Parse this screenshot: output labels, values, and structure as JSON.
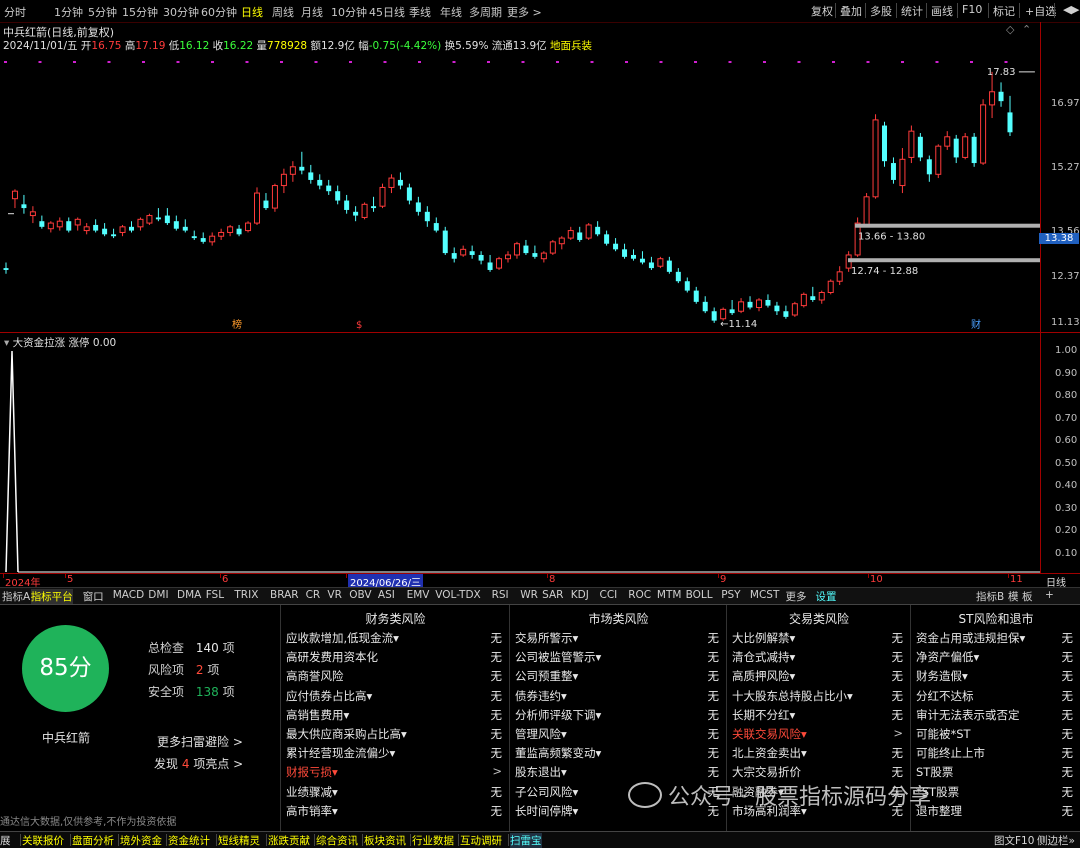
{
  "toolbar": {
    "periods": [
      "分时",
      "1分钟",
      "5分钟",
      "15分钟",
      "30分钟",
      "60分钟",
      "日线",
      "周线",
      "月线",
      "10分钟",
      "45日线",
      "季线",
      "年线",
      "多周期",
      "更多 >"
    ],
    "active_period": "日线",
    "right_buttons": [
      "复权",
      "叠加",
      "多股",
      "统计",
      "画线",
      "F10",
      "标记",
      "+自选",
      "◀",
      "▶"
    ]
  },
  "info": {
    "stock_title": "中兵红箭(日线,前复权)",
    "date": "2024/11/01/五",
    "open_label": "开",
    "open": "16.75",
    "high_label": "高",
    "high": "17.19",
    "low_label": "低",
    "low": "16.12",
    "close_label": "收",
    "close": "16.22",
    "vol_label": "量",
    "vol": "778928",
    "amount_label": "额",
    "amount": "12.9亿",
    "change_label": "幅",
    "change": "-0.75(-4.42%)",
    "turnover_label": "换",
    "turnover": "5.59%",
    "float_label": "流通",
    "float": "13.9亿",
    "concept": "地面兵装"
  },
  "price_axis": {
    "ticks": [
      "16.97",
      "15.27",
      "13.56",
      "12.37",
      "11.13"
    ],
    "current": "13.38"
  },
  "chart_data": {
    "type": "candlestick",
    "annotations": {
      "high_label": "17.83",
      "low_label": "11.14",
      "zone_upper": "13.66 - 13.80",
      "zone_lower": "12.74 - 12.88"
    },
    "markers": [
      "榜",
      "$",
      "财"
    ],
    "ohlc": [
      [
        12.6,
        12.75,
        12.45,
        12.55
      ],
      [
        14.45,
        14.7,
        14.2,
        14.65
      ],
      [
        14.3,
        14.55,
        14.05,
        14.2
      ],
      [
        14.0,
        14.25,
        13.8,
        14.1
      ],
      [
        13.85,
        14.0,
        13.65,
        13.7
      ],
      [
        13.65,
        13.85,
        13.55,
        13.8
      ],
      [
        13.7,
        13.95,
        13.6,
        13.85
      ],
      [
        13.85,
        13.95,
        13.55,
        13.6
      ],
      [
        13.75,
        13.95,
        13.6,
        13.9
      ],
      [
        13.6,
        13.8,
        13.5,
        13.7
      ],
      [
        13.75,
        13.9,
        13.55,
        13.6
      ],
      [
        13.65,
        13.8,
        13.45,
        13.5
      ],
      [
        13.5,
        13.65,
        13.4,
        13.45
      ],
      [
        13.55,
        13.75,
        13.45,
        13.7
      ],
      [
        13.7,
        13.85,
        13.55,
        13.6
      ],
      [
        13.7,
        13.95,
        13.6,
        13.9
      ],
      [
        13.8,
        14.05,
        13.75,
        14.0
      ],
      [
        13.95,
        14.2,
        13.85,
        13.9
      ],
      [
        14.0,
        14.2,
        13.75,
        13.8
      ],
      [
        13.85,
        14.0,
        13.6,
        13.65
      ],
      [
        13.7,
        13.9,
        13.55,
        13.6
      ],
      [
        13.45,
        13.6,
        13.35,
        13.4
      ],
      [
        13.4,
        13.55,
        13.25,
        13.3
      ],
      [
        13.3,
        13.55,
        13.2,
        13.45
      ],
      [
        13.45,
        13.65,
        13.35,
        13.55
      ],
      [
        13.55,
        13.75,
        13.45,
        13.7
      ],
      [
        13.65,
        13.75,
        13.45,
        13.5
      ],
      [
        13.6,
        13.85,
        13.55,
        13.8
      ],
      [
        13.8,
        14.75,
        13.75,
        14.6
      ],
      [
        14.4,
        14.6,
        14.15,
        14.2
      ],
      [
        14.2,
        14.85,
        14.1,
        14.8
      ],
      [
        14.8,
        15.25,
        14.6,
        15.1
      ],
      [
        15.1,
        15.45,
        14.9,
        15.3
      ],
      [
        15.3,
        15.7,
        15.1,
        15.2
      ],
      [
        15.15,
        15.35,
        14.85,
        14.95
      ],
      [
        14.95,
        15.1,
        14.7,
        14.8
      ],
      [
        14.8,
        14.95,
        14.55,
        14.65
      ],
      [
        14.65,
        14.8,
        14.3,
        14.4
      ],
      [
        14.4,
        14.55,
        14.05,
        14.15
      ],
      [
        14.1,
        14.25,
        13.85,
        14.0
      ],
      [
        13.95,
        14.35,
        13.9,
        14.3
      ],
      [
        14.25,
        14.5,
        14.1,
        14.2
      ],
      [
        14.25,
        14.85,
        14.2,
        14.75
      ],
      [
        14.75,
        15.1,
        14.6,
        15.0
      ],
      [
        14.95,
        15.15,
        14.7,
        14.8
      ],
      [
        14.75,
        14.85,
        14.3,
        14.4
      ],
      [
        14.35,
        14.5,
        14.0,
        14.1
      ],
      [
        14.1,
        14.25,
        13.7,
        13.85
      ],
      [
        13.8,
        13.95,
        13.55,
        13.6
      ],
      [
        13.6,
        13.7,
        12.95,
        13.0
      ],
      [
        13.0,
        13.15,
        12.75,
        12.85
      ],
      [
        12.95,
        13.2,
        12.9,
        13.1
      ],
      [
        13.05,
        13.2,
        12.85,
        12.95
      ],
      [
        12.95,
        13.05,
        12.7,
        12.8
      ],
      [
        12.75,
        12.95,
        12.5,
        12.55
      ],
      [
        12.6,
        12.9,
        12.55,
        12.85
      ],
      [
        12.85,
        13.05,
        12.75,
        12.95
      ],
      [
        12.95,
        13.3,
        12.85,
        13.25
      ],
      [
        13.2,
        13.35,
        12.95,
        13.0
      ],
      [
        13.0,
        13.2,
        12.85,
        12.9
      ],
      [
        12.85,
        13.05,
        12.75,
        13.0
      ],
      [
        13.0,
        13.35,
        12.95,
        13.3
      ],
      [
        13.25,
        13.45,
        13.1,
        13.4
      ],
      [
        13.4,
        13.7,
        13.35,
        13.6
      ],
      [
        13.55,
        13.7,
        13.3,
        13.35
      ],
      [
        13.4,
        13.8,
        13.35,
        13.75
      ],
      [
        13.7,
        13.85,
        13.45,
        13.5
      ],
      [
        13.5,
        13.6,
        13.2,
        13.25
      ],
      [
        13.25,
        13.4,
        13.05,
        13.1
      ],
      [
        13.1,
        13.25,
        12.85,
        12.9
      ],
      [
        12.95,
        13.1,
        12.8,
        12.85
      ],
      [
        12.85,
        13.05,
        12.7,
        12.75
      ],
      [
        12.75,
        12.9,
        12.55,
        12.6
      ],
      [
        12.65,
        12.9,
        12.6,
        12.85
      ],
      [
        12.8,
        12.9,
        12.45,
        12.5
      ],
      [
        12.5,
        12.6,
        12.2,
        12.25
      ],
      [
        12.25,
        12.35,
        11.95,
        12.0
      ],
      [
        12.0,
        12.1,
        11.65,
        11.7
      ],
      [
        11.7,
        11.85,
        11.4,
        11.45
      ],
      [
        11.45,
        11.55,
        11.14,
        11.2
      ],
      [
        11.25,
        11.55,
        11.2,
        11.5
      ],
      [
        11.5,
        11.75,
        11.35,
        11.4
      ],
      [
        11.45,
        11.8,
        11.4,
        11.7
      ],
      [
        11.7,
        11.85,
        11.5,
        11.55
      ],
      [
        11.55,
        11.8,
        11.45,
        11.75
      ],
      [
        11.75,
        11.9,
        11.55,
        11.6
      ],
      [
        11.6,
        11.7,
        11.35,
        11.45
      ],
      [
        11.45,
        11.6,
        11.25,
        11.3
      ],
      [
        11.35,
        11.7,
        11.3,
        11.65
      ],
      [
        11.6,
        11.95,
        11.55,
        11.9
      ],
      [
        11.85,
        12.1,
        11.7,
        11.75
      ],
      [
        11.75,
        12.0,
        11.65,
        11.95
      ],
      [
        11.95,
        12.3,
        11.9,
        12.25
      ],
      [
        12.25,
        12.65,
        12.15,
        12.5
      ],
      [
        12.6,
        13.05,
        12.5,
        12.95
      ],
      [
        12.95,
        13.95,
        12.9,
        13.8
      ],
      [
        13.75,
        14.6,
        13.7,
        14.5
      ],
      [
        14.5,
        16.7,
        14.45,
        16.55
      ],
      [
        16.4,
        16.5,
        15.3,
        15.45
      ],
      [
        15.4,
        15.55,
        14.85,
        14.95
      ],
      [
        14.8,
        15.8,
        14.6,
        15.5
      ],
      [
        15.55,
        16.4,
        15.4,
        16.25
      ],
      [
        16.1,
        16.2,
        15.45,
        15.55
      ],
      [
        15.5,
        15.6,
        14.9,
        15.1
      ],
      [
        15.1,
        15.9,
        15.0,
        15.85
      ],
      [
        15.85,
        16.25,
        15.75,
        16.1
      ],
      [
        16.05,
        16.15,
        15.4,
        15.55
      ],
      [
        15.55,
        16.2,
        15.5,
        16.1
      ],
      [
        16.1,
        16.2,
        15.3,
        15.4
      ],
      [
        15.4,
        17.1,
        15.35,
        16.95
      ],
      [
        16.95,
        17.83,
        16.6,
        17.3
      ],
      [
        17.3,
        17.55,
        16.9,
        17.05
      ],
      [
        16.75,
        17.19,
        16.12,
        16.22
      ]
    ],
    "indicator": {
      "name": "大资金拉涨",
      "series_name": "涨停",
      "value": "0.00",
      "ticks": [
        "1.00",
        "0.90",
        "0.80",
        "0.70",
        "0.60",
        "0.50",
        "0.40",
        "0.30",
        "0.20",
        "0.10"
      ]
    }
  },
  "date_axis": {
    "labels": [
      "2024年",
      "5",
      "6",
      "2024/06/26/三",
      "8",
      "9",
      "10",
      "11"
    ],
    "right_label": "日线"
  },
  "tabs": [
    "指标A",
    "指标平台",
    "窗口",
    "MACD",
    "DMI",
    "DMA",
    "FSL",
    "TRIX",
    "BRAR",
    "CR",
    "VR",
    "OBV",
    "ASI",
    "EMV",
    "VOL-TDX",
    "RSI",
    "WR",
    "SAR",
    "KDJ",
    "CCI",
    "ROC",
    "MTM",
    "BOLL",
    "PSY",
    "MCST",
    "更多",
    "设置"
  ],
  "tabs_right": [
    "指标B",
    "模",
    "板",
    "+"
  ],
  "risk": {
    "score": "85分",
    "stock_name": "中兵红箭",
    "total_label": "总检查",
    "total": "140",
    "total_unit": "项",
    "risk_label": "风险项",
    "risk": "2",
    "risk_unit": "项",
    "safe_label": "安全项",
    "safe": "138",
    "safe_unit": "项",
    "more_link": "更多扫雷避险 >",
    "found_prefix": "发现",
    "found": "4",
    "found_suffix": "项亮点 >",
    "disclaimer": "通达信大数据,仅供参考,不作为投资依据",
    "columns": [
      {
        "title": "财务类风险",
        "items": [
          {
            "label": "应收款增加,低现金流▾",
            "value": "无",
            "red": false
          },
          {
            "label": "高研发费用资本化",
            "value": "无",
            "red": false
          },
          {
            "label": "高商誉风险",
            "value": "无",
            "red": false
          },
          {
            "label": "应付债券占比高▾",
            "value": "无",
            "red": false
          },
          {
            "label": "高销售费用▾",
            "value": "无",
            "red": false
          },
          {
            "label": "最大供应商采购占比高▾",
            "value": "无",
            "red": false
          },
          {
            "label": "累计经营现金流偏少▾",
            "value": "无",
            "red": false
          },
          {
            "label": "财报亏损▾",
            "value": ">",
            "red": true
          },
          {
            "label": "业绩骤减▾",
            "value": "无",
            "red": false
          },
          {
            "label": "高市销率▾",
            "value": "无",
            "red": false
          }
        ]
      },
      {
        "title": "市场类风险",
        "items": [
          {
            "label": "交易所警示▾",
            "value": "无",
            "red": false
          },
          {
            "label": "公司被监管警示▾",
            "value": "无",
            "red": false
          },
          {
            "label": "公司预重整▾",
            "value": "无",
            "red": false
          },
          {
            "label": "债券违约▾",
            "value": "无",
            "red": false
          },
          {
            "label": "分析师评级下调▾",
            "value": "无",
            "red": false
          },
          {
            "label": "管理风险▾",
            "value": "无",
            "red": false
          },
          {
            "label": "董监高频繁变动▾",
            "value": "无",
            "red": false
          },
          {
            "label": "股东退出▾",
            "value": "无",
            "red": false
          },
          {
            "label": "子公司风险▾",
            "value": "无",
            "red": false
          },
          {
            "label": "长时间停牌▾",
            "value": "无",
            "red": false
          }
        ]
      },
      {
        "title": "交易类风险",
        "items": [
          {
            "label": "大比例解禁▾",
            "value": "无",
            "red": false
          },
          {
            "label": "清仓式减持▾",
            "value": "无",
            "red": false
          },
          {
            "label": "高质押风险▾",
            "value": "无",
            "red": false
          },
          {
            "label": "十大股东总持股占比小▾",
            "value": "无",
            "red": false
          },
          {
            "label": "长期不分红▾",
            "value": "无",
            "red": false
          },
          {
            "label": "关联交易风险▾",
            "value": ">",
            "red": true
          },
          {
            "label": "北上资金卖出▾",
            "value": "无",
            "red": false
          },
          {
            "label": "大宗交易折价",
            "value": "无",
            "red": false
          },
          {
            "label": "融资融券▾",
            "value": "无",
            "red": false
          },
          {
            "label": "市场高利润率▾",
            "value": "无",
            "red": false
          }
        ]
      },
      {
        "title": "ST风险和退市",
        "items": [
          {
            "label": "资金占用或违规担保▾",
            "value": "无",
            "red": false
          },
          {
            "label": "净资产偏低▾",
            "value": "无",
            "red": false
          },
          {
            "label": "财务造假▾",
            "value": "无",
            "red": false
          },
          {
            "label": "分红不达标",
            "value": "无",
            "red": false
          },
          {
            "label": "审计无法表示或否定",
            "value": "无",
            "red": false
          },
          {
            "label": "可能被*ST",
            "value": "无",
            "red": false
          },
          {
            "label": "可能终止上市",
            "value": "无",
            "red": false
          },
          {
            "label": "ST股票",
            "value": "无",
            "red": false
          },
          {
            "label": "*ST股票",
            "value": "无",
            "red": false
          },
          {
            "label": "退市整理",
            "value": "无",
            "red": false
          }
        ]
      }
    ]
  },
  "watermark": "公众号 · 股票指标源码分享",
  "bottom_tabs": [
    "展",
    "关联报价",
    "盘面分析",
    "境外资金",
    "资金统计",
    "短线精灵",
    "涨跌贡献",
    "综合资讯",
    "板块资讯",
    "行业数据",
    "互动调研",
    "扫雷宝"
  ],
  "bottom_right": [
    "图文F10",
    "侧边栏»"
  ],
  "colors": {
    "up": "#ff3b3b",
    "down": "#54ffff",
    "grid": "#a00000",
    "yellow": "#ffff00",
    "green": "#1fb35a"
  }
}
